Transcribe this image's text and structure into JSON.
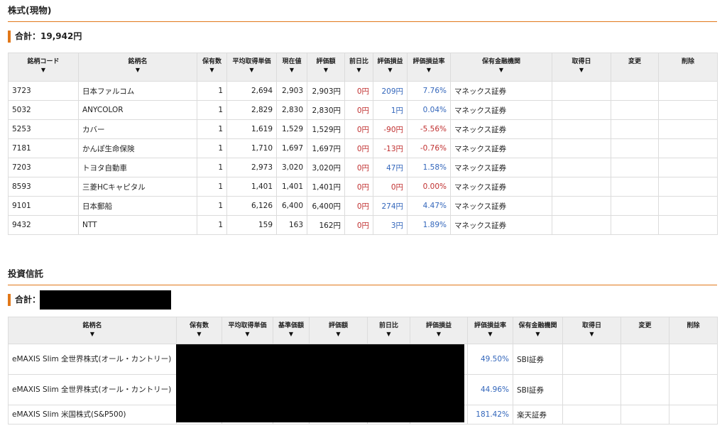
{
  "stocks": {
    "title": "株式(現物)",
    "total_label": "合計：",
    "total_value": "19,942円",
    "headers": [
      {
        "label": "銘柄コード",
        "sortable": true
      },
      {
        "label": "銘柄名",
        "sortable": true
      },
      {
        "label": "保有数",
        "sortable": true
      },
      {
        "label": "平均取得単価",
        "sortable": true
      },
      {
        "label": "現在値",
        "sortable": true
      },
      {
        "label": "評価額",
        "sortable": true
      },
      {
        "label": "前日比",
        "sortable": true
      },
      {
        "label": "評価損益",
        "sortable": true
      },
      {
        "label": "評価損益率",
        "sortable": true
      },
      {
        "label": "保有金融機関",
        "sortable": true
      },
      {
        "label": "取得日",
        "sortable": true
      },
      {
        "label": "変更",
        "sortable": false
      },
      {
        "label": "削除",
        "sortable": false
      }
    ],
    "sort_glyph": "▼",
    "rows": [
      {
        "code": "3723",
        "name": "日本ファルコム",
        "qty": "1",
        "avg": "2,694",
        "price": "2,903",
        "value": "2,903円",
        "change": "0円",
        "pl": "209円",
        "pl_rate": "7.76%",
        "inst": "マネックス証券"
      },
      {
        "code": "5032",
        "name": "ANYCOLOR",
        "qty": "1",
        "avg": "2,829",
        "price": "2,830",
        "value": "2,830円",
        "change": "0円",
        "pl": "1円",
        "pl_rate": "0.04%",
        "inst": "マネックス証券"
      },
      {
        "code": "5253",
        "name": "カバー",
        "qty": "1",
        "avg": "1,619",
        "price": "1,529",
        "value": "1,529円",
        "change": "0円",
        "pl": "-90円",
        "pl_rate": "-5.56%",
        "inst": "マネックス証券"
      },
      {
        "code": "7181",
        "name": "かんぽ生命保険",
        "qty": "1",
        "avg": "1,710",
        "price": "1,697",
        "value": "1,697円",
        "change": "0円",
        "pl": "-13円",
        "pl_rate": "-0.76%",
        "inst": "マネックス証券"
      },
      {
        "code": "7203",
        "name": "トヨタ自動車",
        "qty": "1",
        "avg": "2,973",
        "price": "3,020",
        "value": "3,020円",
        "change": "0円",
        "pl": "47円",
        "pl_rate": "1.58%",
        "inst": "マネックス証券"
      },
      {
        "code": "8593",
        "name": "三菱HCキャピタル",
        "qty": "1",
        "avg": "1,401",
        "price": "1,401",
        "value": "1,401円",
        "change": "0円",
        "pl": "0円",
        "pl_rate": "0.00%",
        "inst": "マネックス証券"
      },
      {
        "code": "9101",
        "name": "日本郵船",
        "qty": "1",
        "avg": "6,126",
        "price": "6,400",
        "value": "6,400円",
        "change": "0円",
        "pl": "274円",
        "pl_rate": "4.47%",
        "inst": "マネックス証券"
      },
      {
        "code": "9432",
        "name": "NTT",
        "qty": "1",
        "avg": "159",
        "price": "163",
        "value": "162円",
        "change": "0円",
        "pl": "3円",
        "pl_rate": "1.89%",
        "inst": "マネックス証券"
      }
    ]
  },
  "funds": {
    "title": "投資信託",
    "total_label": "合計：",
    "headers": [
      {
        "label": "銘柄名",
        "sortable": true
      },
      {
        "label": "保有数",
        "sortable": true
      },
      {
        "label": "平均取得単価",
        "sortable": true
      },
      {
        "label": "基準価額",
        "sortable": true
      },
      {
        "label": "評価額",
        "sortable": true
      },
      {
        "label": "前日比",
        "sortable": true
      },
      {
        "label": "評価損益",
        "sortable": true
      },
      {
        "label": "評価損益率",
        "sortable": true
      },
      {
        "label": "保有金融機関",
        "sortable": true
      },
      {
        "label": "取得日",
        "sortable": true
      },
      {
        "label": "変更",
        "sortable": false
      },
      {
        "label": "削除",
        "sortable": false
      }
    ],
    "rows": [
      {
        "name": "eMAXIS Slim 全世界株式(オール・カントリー)",
        "pl_rate": "49.50%",
        "inst": "SBI証券"
      },
      {
        "name": "eMAXIS Slim 全世界株式(オール・カントリー)",
        "pl_rate": "44.96%",
        "inst": "SBI証券"
      },
      {
        "name": "eMAXIS Slim 米国株式(S&P500)",
        "pl_rate": "181.42%",
        "inst": "楽天証券"
      }
    ]
  },
  "colors": {
    "accent": "#e1781a",
    "loss": "#c03030",
    "gain": "#3366bb",
    "header_bg": "#eeeeee"
  }
}
